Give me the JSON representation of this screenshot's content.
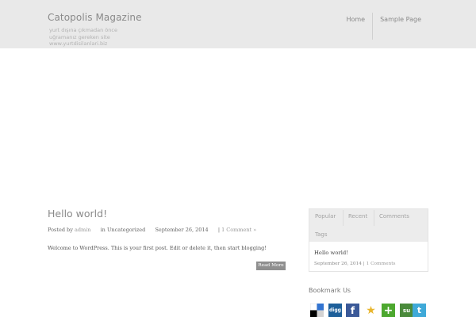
{
  "header": {
    "site_title": "Catopolis Magazine",
    "site_description": "yurt dışına çıkmadan önce uğramanız gereken site www.yurtdisilanlari.biz"
  },
  "nav": {
    "items": [
      {
        "label": "Home"
      },
      {
        "label": "Sample Page"
      }
    ]
  },
  "post": {
    "title": "Hello world!",
    "meta": {
      "posted_by_label": "Posted by",
      "author": "admin",
      "in_label": "in",
      "category": "Uncategorized",
      "date": "September 26, 2014",
      "separator": "|",
      "comments": "1 Comment »"
    },
    "excerpt": "Welcome to WordPress. This is your first post. Edit or delete it, then start blogging!",
    "read_more": "Read More"
  },
  "sidebar": {
    "tabs": [
      {
        "label": "Popular"
      },
      {
        "label": "Recent"
      },
      {
        "label": "Comments"
      },
      {
        "label": "Tags"
      }
    ],
    "popular_item": {
      "title": "Hello world!",
      "date": "September 26, 2014",
      "separator": "|",
      "comments": "1 Comments"
    },
    "bookmark_title": "Bookmark Us",
    "bookmark_icons": [
      {
        "name": "delicious",
        "glyph": "",
        "color": "#3274d1"
      },
      {
        "name": "digg",
        "glyph": "digg",
        "color": "#1d5f9a"
      },
      {
        "name": "facebook",
        "glyph": "f",
        "color": "#3b5998"
      },
      {
        "name": "favorite",
        "glyph": "★",
        "color": "#e8b52c"
      },
      {
        "name": "add",
        "glyph": "+",
        "color": "#4da82f"
      },
      {
        "name": "stumbleupon",
        "glyph": "su",
        "color": "#4a8a3b"
      },
      {
        "name": "twitter",
        "glyph": "t",
        "color": "#3fa9d8"
      }
    ]
  }
}
